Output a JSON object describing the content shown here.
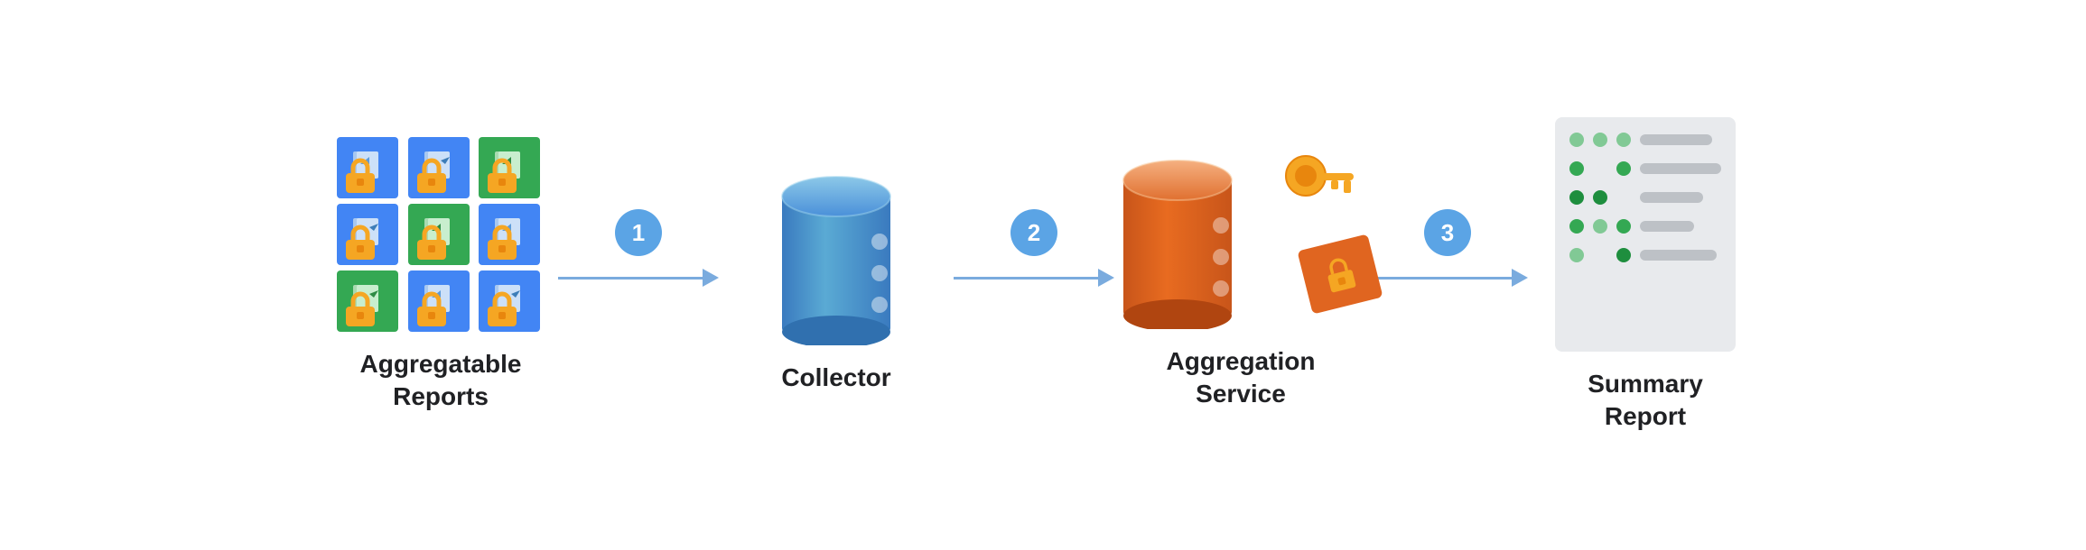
{
  "diagram": {
    "nodes": [
      {
        "id": "aggregatable-reports",
        "label_line1": "Aggregatable",
        "label_line2": "Reports"
      },
      {
        "id": "collector",
        "label_line1": "Collector",
        "label_line2": ""
      },
      {
        "id": "aggregation-service",
        "label_line1": "Aggregation",
        "label_line2": "Service"
      },
      {
        "id": "summary-report",
        "label_line1": "Summary",
        "label_line2": "Report"
      }
    ],
    "arrows": [
      {
        "id": "arrow-1",
        "step": "1"
      },
      {
        "id": "arrow-2",
        "step": "2"
      },
      {
        "id": "arrow-3",
        "step": "3"
      }
    ],
    "colors": {
      "step_circle": "#5ba4e5",
      "arrow": "#7aabde",
      "blue_card": "#4285f4",
      "green_card": "#34a853",
      "collector_blue": "#4a90d9",
      "aggregation_orange": "#e06520",
      "summary_bg": "#e8eaed"
    }
  }
}
